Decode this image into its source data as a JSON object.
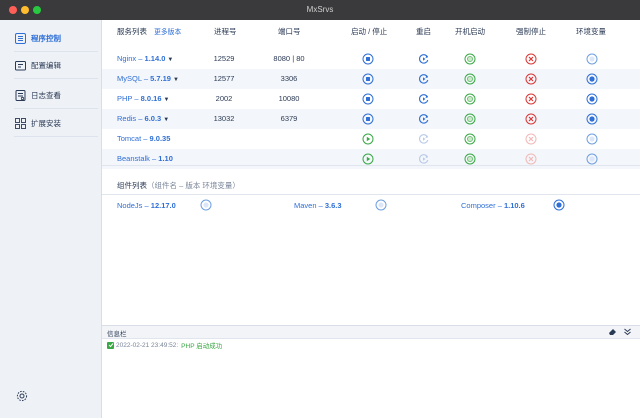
{
  "window": {
    "title": "MxSrvs"
  },
  "sidebar": {
    "items": [
      {
        "label": "程序控制",
        "icon": "list-icon",
        "active": true
      },
      {
        "label": "配置编辑",
        "icon": "config-icon",
        "active": false
      },
      {
        "label": "日志查看",
        "icon": "log-icon",
        "active": false
      },
      {
        "label": "扩展安装",
        "icon": "extension-icon",
        "active": false
      }
    ],
    "settings_icon": "gear-icon"
  },
  "services": {
    "headers": {
      "name": "服务列表",
      "more": "更多版本",
      "pid": "进程号",
      "port": "端口号",
      "start_stop": "启动 / 停止",
      "restart": "重启",
      "autostart": "开机启动",
      "force_stop": "强制停止",
      "env": "环境变量"
    },
    "rows": [
      {
        "name": "Nginx",
        "sep": " – ",
        "version": "1.14.0",
        "dropdown": true,
        "pid": "12529",
        "port": "8080 | 80",
        "state": "running",
        "autostart": true,
        "force_stop": true,
        "env": false
      },
      {
        "name": "MySQL",
        "sep": " – ",
        "version": "5.7.19",
        "dropdown": true,
        "pid": "12577",
        "port": "3306",
        "state": "running",
        "autostart": true,
        "force_stop": true,
        "env": true
      },
      {
        "name": "PHP",
        "sep": " – ",
        "version": "8.0.16",
        "dropdown": true,
        "pid": "2002",
        "port": "10080",
        "state": "running",
        "autostart": true,
        "force_stop": true,
        "env": true
      },
      {
        "name": "Redis",
        "sep": " – ",
        "version": "6.0.3",
        "dropdown": true,
        "pid": "13032",
        "port": "6379",
        "state": "running",
        "autostart": true,
        "force_stop": true,
        "env": true
      },
      {
        "name": "Tomcat",
        "sep": " – ",
        "version": "9.0.35",
        "dropdown": false,
        "pid": "",
        "port": "",
        "state": "stopped",
        "autostart": true,
        "force_stop": false,
        "env": false
      },
      {
        "name": "Beanstalk",
        "sep": " – ",
        "version": "1.10",
        "dropdown": false,
        "pid": "",
        "port": "",
        "state": "stopped",
        "autostart": true,
        "force_stop": false,
        "env": false
      }
    ]
  },
  "components": {
    "title": "组件列表",
    "subtitle": "（组件名 – 版本 环境变量）",
    "items": [
      {
        "name": "NodeJs",
        "sep": " – ",
        "version": "12.17.0",
        "env": false
      },
      {
        "name": "Maven",
        "sep": " – ",
        "version": "3.6.3",
        "env": false
      },
      {
        "name": "Composer",
        "sep": " – ",
        "version": "1.10.6",
        "env": true
      }
    ]
  },
  "info": {
    "label": "信息栏",
    "log": {
      "time": "2022-02-21 23:49:52:",
      "message": "PHP 启动成功"
    }
  },
  "colors": {
    "accent": "#2f6fd6",
    "success": "#39a845",
    "danger": "#d93636",
    "sidebar_bg": "#eef2f7"
  }
}
